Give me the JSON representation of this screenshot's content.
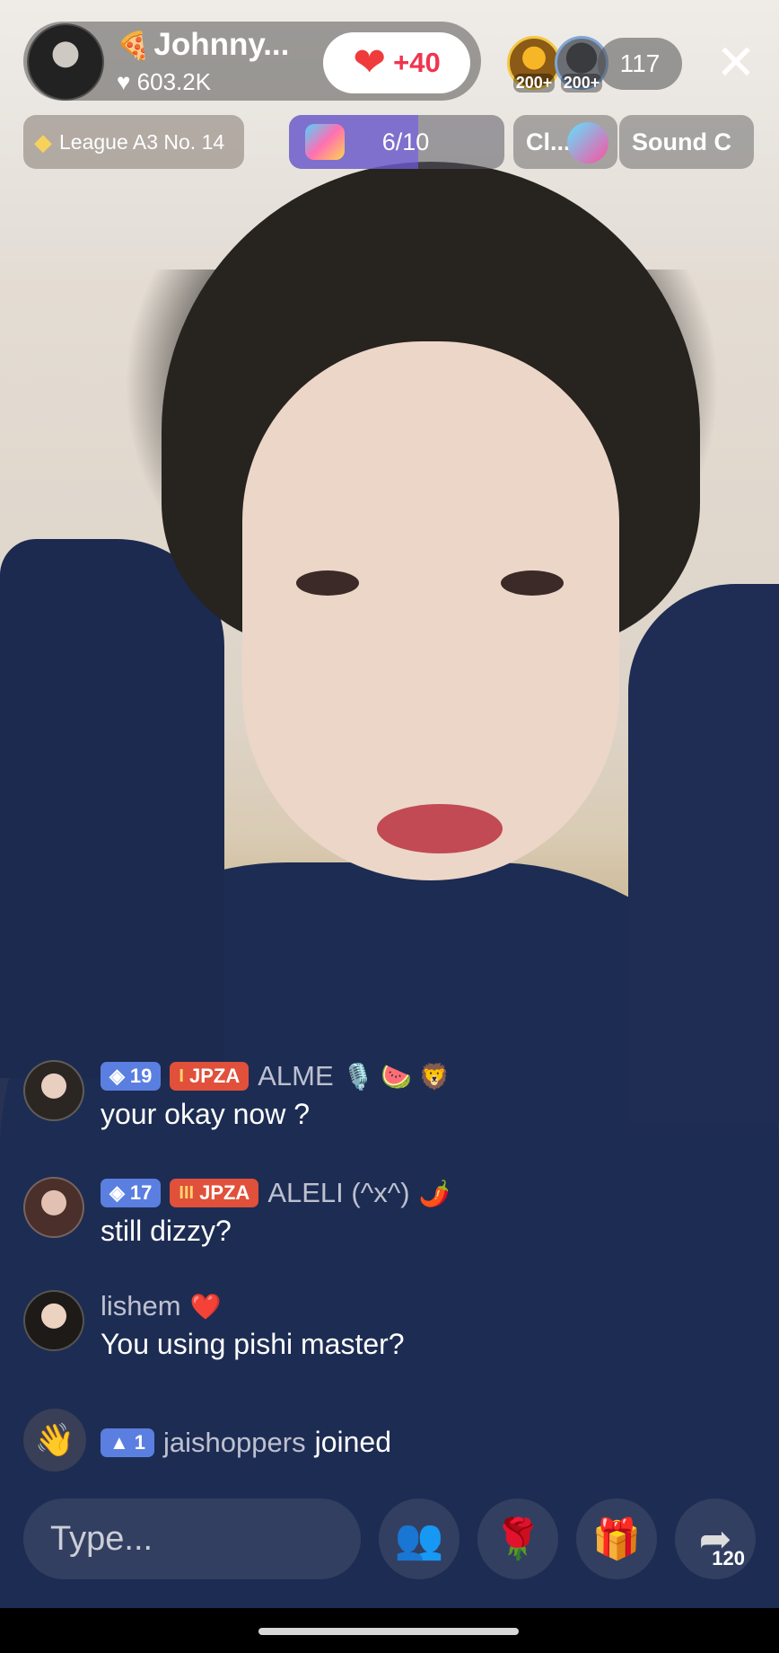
{
  "header": {
    "host_name": "Johnny...",
    "host_emoji": "🍕",
    "host_likes": "603.2K",
    "follow_plus": "+40",
    "viewers": [
      {
        "count_label": "200+"
      },
      {
        "count_label": "200+"
      }
    ],
    "viewer_count": "117"
  },
  "subheader": {
    "league_label": "League A3 No. 14",
    "goal_progress": "6/10",
    "goal_progress_value": 0.6,
    "chip_1": "Cl...",
    "chip_2": "Sound C"
  },
  "comments": [
    {
      "level": "19",
      "fan_level": "I",
      "fan_club": "JPZA",
      "user": "ALME",
      "extra": "🎙️ 🍉 🦁",
      "text": "your okay now ?"
    },
    {
      "level": "17",
      "fan_level": "III",
      "fan_club": "JPZA",
      "user": "ALELI (^x^)",
      "extra": "🌶️",
      "text": "still dizzy?"
    },
    {
      "user": "lishem",
      "extra": "❤️",
      "text": "You using pishi master?"
    }
  ],
  "join_event": {
    "level": "1",
    "user": "jaishoppers",
    "action": "joined"
  },
  "bottom_bar": {
    "input_placeholder": "Type...",
    "share_count": "120"
  },
  "colors": {
    "follow_heart": "#ef3b3b",
    "level_badge": "#5a7fe0",
    "fan_badge": "#e0503a",
    "goal_fill": "#6e5ae6"
  }
}
